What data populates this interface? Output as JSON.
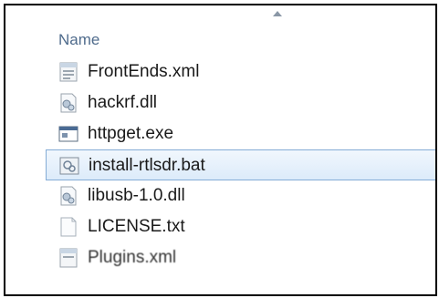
{
  "header": {
    "name_column": "Name"
  },
  "files": [
    {
      "name": "FrontEnds.xml",
      "icon": "xml-file-icon",
      "selected": false
    },
    {
      "name": "hackrf.dll",
      "icon": "dll-file-icon",
      "selected": false
    },
    {
      "name": "httpget.exe",
      "icon": "exe-file-icon",
      "selected": false
    },
    {
      "name": "install-rtlsdr.bat",
      "icon": "bat-file-icon",
      "selected": true
    },
    {
      "name": "libusb-1.0.dll",
      "icon": "dll-file-icon",
      "selected": false
    },
    {
      "name": "LICENSE.txt",
      "icon": "txt-file-icon",
      "selected": false
    },
    {
      "name": "Plugins.xml",
      "icon": "xml-file-icon",
      "selected": false
    }
  ]
}
